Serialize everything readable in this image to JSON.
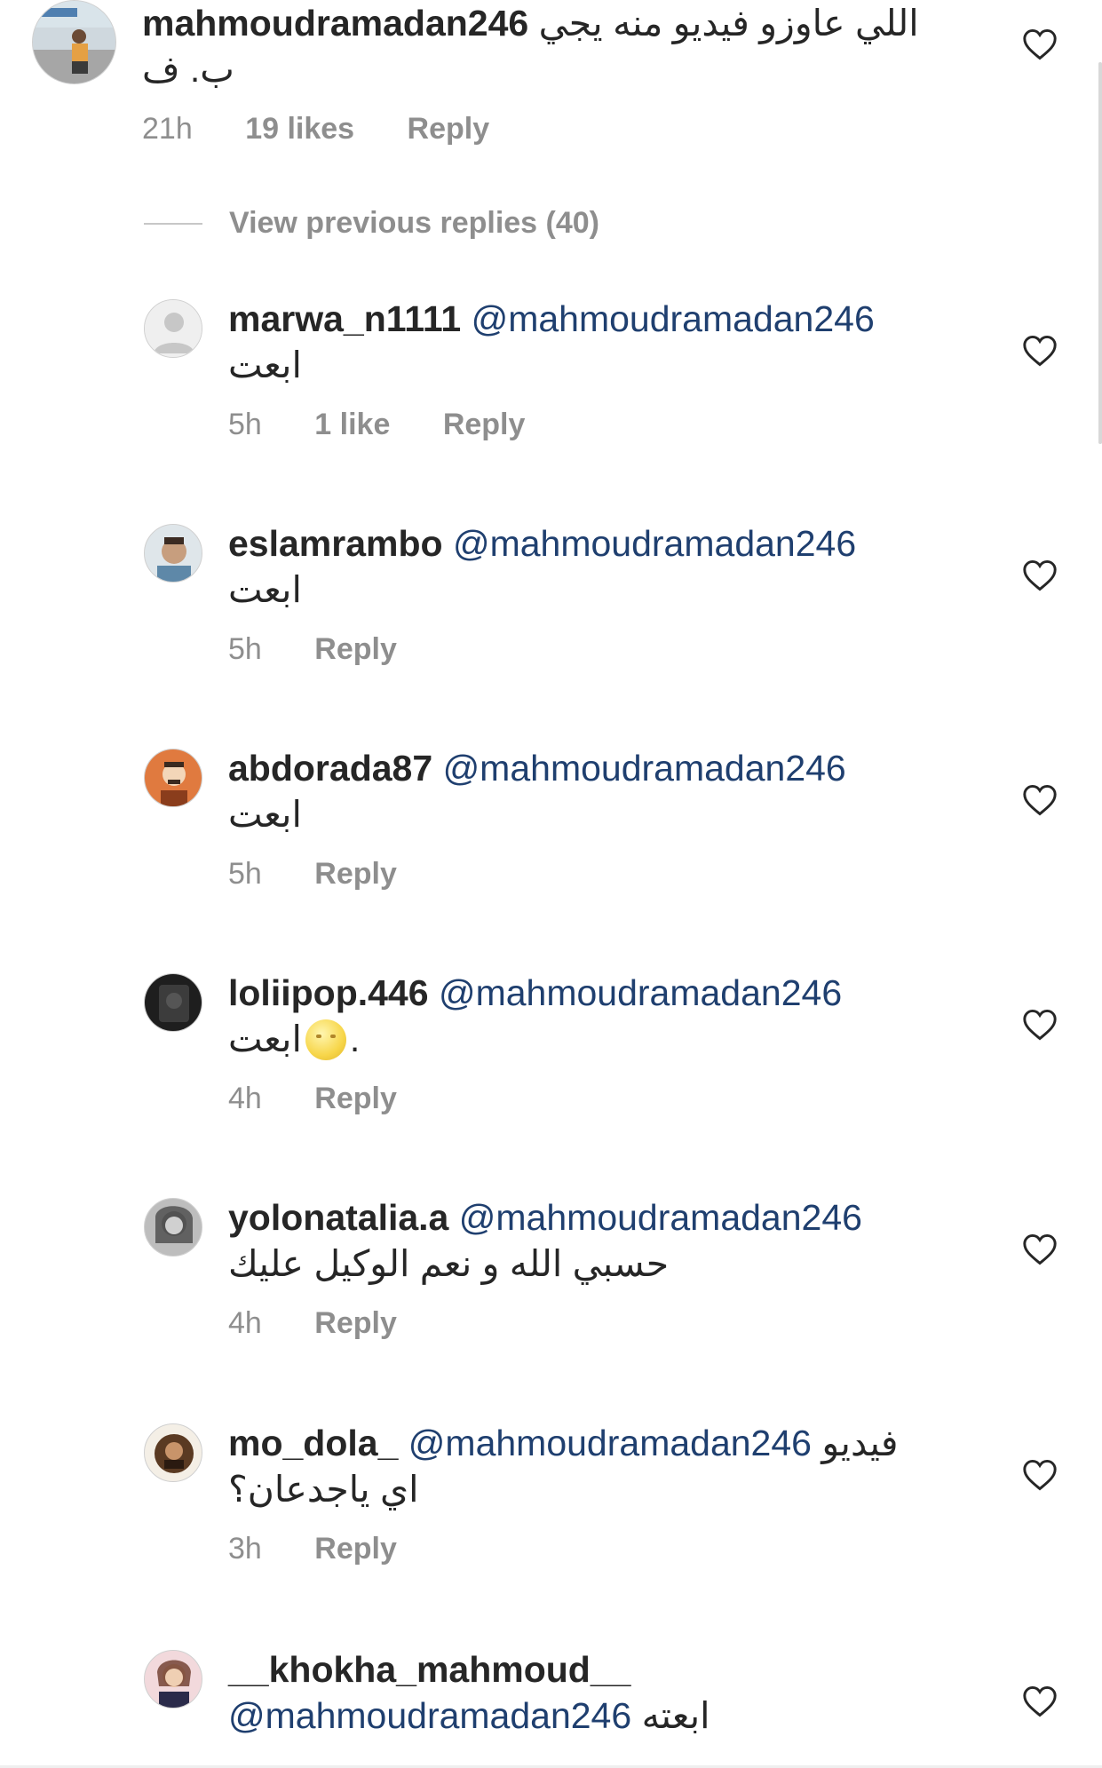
{
  "main_comment": {
    "username": "mahmoudramadan246",
    "text_line1": "اللي عاوزو فيديو منه يجي",
    "text_line2": "ب. ف",
    "time": "21h",
    "likes": "19 likes",
    "reply_label": "Reply"
  },
  "view_previous_replies": "View previous replies (40)",
  "replies": [
    {
      "username": "marwa_n1111",
      "mention": "@mahmoudramadan246",
      "text": "ابعت",
      "time": "5h",
      "likes": "1 like",
      "reply_label": "Reply"
    },
    {
      "username": "eslamrambo",
      "mention": "@mahmoudramadan246",
      "text": "ابعت",
      "time": "5h",
      "reply_label": "Reply"
    },
    {
      "username": "abdorada87",
      "mention": "@mahmoudramadan246",
      "text": "ابعت",
      "time": "5h",
      "reply_label": "Reply"
    },
    {
      "username": "loliipop.446",
      "mention": "@mahmoudramadan246",
      "text": "ابعت",
      "text_suffix": ".",
      "emoji": "moon-face-emoji",
      "time": "4h",
      "reply_label": "Reply"
    },
    {
      "username": "yolonatalia.a",
      "mention": "@mahmoudramadan246",
      "text": "حسبي الله و نعم الوكيل عليك",
      "time": "4h",
      "reply_label": "Reply"
    },
    {
      "username": "mo_dola_",
      "mention": "@mahmoudramadan246",
      "text_inline": "فيديو",
      "text": "اي ياجدعان؟",
      "time": "3h",
      "reply_label": "Reply"
    },
    {
      "username": "__khokha_mahmoud__",
      "mention": "@mahmoudramadan246",
      "text": "ابعته"
    }
  ],
  "colors": {
    "mention": "#1f3f6f",
    "meta": "#8e8e8e",
    "text": "#262626"
  },
  "icons": {
    "like": "heart-outline-icon"
  }
}
